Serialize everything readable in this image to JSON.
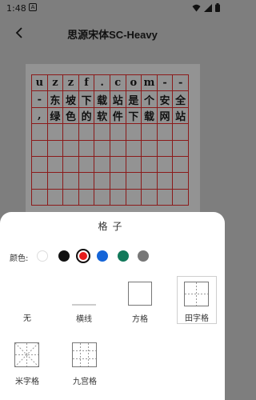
{
  "status_bar": {
    "time": "1:48",
    "notification_glyph": "A",
    "icons": [
      "wifi-icon",
      "signal-icon",
      "battery-icon"
    ]
  },
  "app_bar": {
    "title": "思源宋体SC-Heavy",
    "back_icon": "chevron-left-icon"
  },
  "preview": {
    "rows": [
      [
        "u",
        "z",
        "z",
        "f",
        ".",
        "c",
        "o",
        "m",
        "-",
        "-"
      ],
      [
        "-",
        "东",
        "坡",
        "下",
        "载",
        "站",
        "是",
        "个",
        "安",
        "全"
      ],
      [
        ",",
        "绿",
        "色",
        "的",
        "软",
        "件",
        "下",
        "载",
        "网",
        "站"
      ],
      [
        "",
        "",
        "",
        "",
        "",
        "",
        "",
        "",
        "",
        ""
      ],
      [
        "",
        "",
        "",
        "",
        "",
        "",
        "",
        "",
        "",
        ""
      ],
      [
        "",
        "",
        "",
        "",
        "",
        "",
        "",
        "",
        "",
        ""
      ],
      [
        "",
        "",
        "",
        "",
        "",
        "",
        "",
        "",
        "",
        ""
      ],
      [
        "",
        "",
        "",
        "",
        "",
        "",
        "",
        "",
        "",
        ""
      ]
    ]
  },
  "sheet": {
    "title": "格子",
    "color_label": "颜色:",
    "colors": [
      "#ffffff",
      "#111111",
      "#e81c1c",
      "#1565d8",
      "#12795a",
      "#777777"
    ],
    "selected_color": "#e81c1c",
    "options": {
      "none": "无",
      "lines": "横线",
      "square": "方格",
      "tian": "田字格",
      "mi": "米字格",
      "jiugong": "九宫格"
    },
    "selected_option": "田字格"
  }
}
